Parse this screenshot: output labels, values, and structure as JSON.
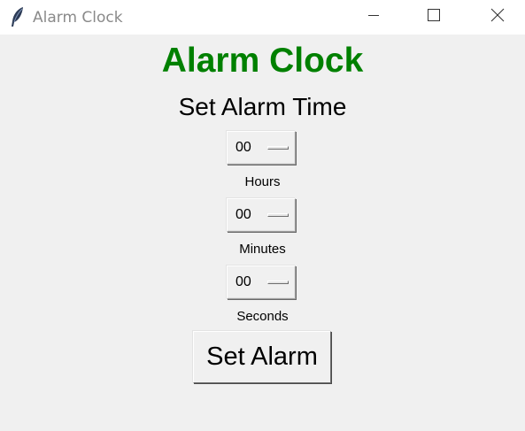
{
  "window": {
    "title": "Alarm Clock",
    "icon": "feather-icon",
    "controls": {
      "minimize": "minimize-icon",
      "maximize": "maximize-icon",
      "close": "close-icon"
    }
  },
  "app": {
    "heading": "Alarm Clock",
    "heading_color": "#008000",
    "subheading": "Set Alarm Time"
  },
  "fields": {
    "hours": {
      "value": "00",
      "label": "Hours"
    },
    "minutes": {
      "value": "00",
      "label": "Minutes"
    },
    "seconds": {
      "value": "00",
      "label": "Seconds"
    }
  },
  "actions": {
    "set_alarm_label": "Set Alarm"
  }
}
